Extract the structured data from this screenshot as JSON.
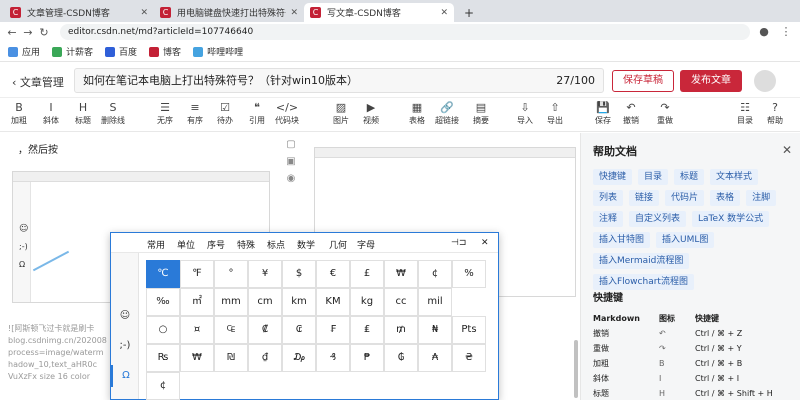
{
  "browser": {
    "tabs": [
      {
        "title": "文章管理-CSDN博客",
        "fav": "C"
      },
      {
        "title": "用电脑键盘快速打出特殊符号 |",
        "fav": "C"
      },
      {
        "title": "写文章-CSDN博客",
        "fav": "C"
      }
    ],
    "url": "editor.csdn.net/md?articleId=107746640",
    "bookmarks": [
      {
        "label": "应用",
        "color": "#4a90e2",
        "icon": "apps-icon"
      },
      {
        "label": "计薪客",
        "color": "#3aa757",
        "icon": "bookmark-icon"
      },
      {
        "label": "百度",
        "color": "#2f5fd8",
        "icon": "bookmark-icon"
      },
      {
        "label": "博客",
        "color": "#c32136",
        "icon": "bookmark-icon"
      },
      {
        "label": "哔哩哔哩",
        "color": "#45a3e0",
        "icon": "bookmark-icon"
      }
    ]
  },
  "editor": {
    "back_label": "文章管理",
    "title": "如何在笔记本电脑上打出特殊符号？（针对win10版本）",
    "char_count": "27/100",
    "save_draft": "保存草稿",
    "publish": "发布文章",
    "toolbar": [
      {
        "label": "加粗",
        "icon": "B"
      },
      {
        "label": "斜体",
        "icon": "I"
      },
      {
        "label": "标题",
        "icon": "H"
      },
      {
        "label": "删除线",
        "icon": "S"
      },
      {
        "label": "无序",
        "icon": "☰"
      },
      {
        "label": "有序",
        "icon": "≡"
      },
      {
        "label": "待办",
        "icon": "☑"
      },
      {
        "label": "引用",
        "icon": "❝"
      },
      {
        "label": "代码块",
        "icon": "</>"
      },
      {
        "label": "图片",
        "icon": "▨"
      },
      {
        "label": "视频",
        "icon": "▶"
      },
      {
        "label": "表格",
        "icon": "▦"
      },
      {
        "label": "超链接",
        "icon": "🔗"
      },
      {
        "label": "摘要",
        "icon": "▤"
      },
      {
        "label": "导入",
        "icon": "⇩"
      },
      {
        "label": "导出",
        "icon": "⇧"
      },
      {
        "label": "保存",
        "icon": "💾"
      },
      {
        "label": "撤销",
        "icon": "↶"
      },
      {
        "label": "重做",
        "icon": "↷"
      },
      {
        "label": "目录",
        "icon": "☷"
      },
      {
        "label": "帮助",
        "icon": "?"
      }
    ],
    "content_line": "，然后按",
    "ocr_text": [
      "![阿斯顿飞过卡就是刷卡",
      "blog.csdnimg.cn/202008",
      "process=image/waterm",
      "hadow_10,text_aHR0c",
      "VuXzFx size 16 color"
    ]
  },
  "ime": {
    "tabs": [
      "常用",
      "单位",
      "序号",
      "特殊",
      "标点",
      "数学",
      "几何",
      "字母"
    ],
    "pin_icon": "⊣⊐",
    "close_icon": "✕",
    "side": [
      {
        "label": "☺",
        "icon": "emoji-icon"
      },
      {
        "label": ";-)",
        "icon": "emoticon-icon"
      },
      {
        "label": "Ω",
        "icon": "symbol-icon"
      }
    ],
    "symbols": [
      "℃",
      "℉",
      "°",
      "¥",
      "$",
      "€",
      "£",
      "₩",
      "¢",
      "%",
      "‰",
      "㎡",
      "mm",
      "cm",
      "km",
      "KM",
      "kg",
      "cc",
      "mil",
      "",
      "○",
      "¤",
      "₠",
      "₡",
      "₢",
      "₣",
      "₤",
      "₥",
      "₦",
      "Pts",
      "₨",
      "₩",
      "₪",
      "₫",
      "₯",
      "₰",
      "₱",
      "₲",
      "₳",
      "₴",
      "¢"
    ]
  },
  "help": {
    "title": "帮助文档",
    "chips": [
      "快捷键",
      "目录",
      "标题",
      "文本样式",
      "列表",
      "链接",
      "代码片",
      "表格",
      "注脚",
      "注释",
      "自定义列表",
      "LaTeX 数学公式",
      "插入甘特图",
      "插入UML图",
      "插入Mermaid流程图",
      "插入Flowchart流程图"
    ],
    "shortcut_title": "快捷键",
    "table_head": [
      "Markdown",
      "图标",
      "快捷键"
    ],
    "rows": [
      {
        "name": "撤销",
        "icon": "↶",
        "key": "Ctrl / ⌘ + Z"
      },
      {
        "name": "重做",
        "icon": "↷",
        "key": "Ctrl / ⌘ + Y"
      },
      {
        "name": "加粗",
        "icon": "B",
        "key": "Ctrl / ⌘ + B"
      },
      {
        "name": "斜体",
        "icon": "I",
        "key": "Ctrl / ⌘ + I"
      },
      {
        "name": "标题",
        "icon": "H",
        "key": "Ctrl / ⌘ + Shift + H"
      }
    ]
  }
}
